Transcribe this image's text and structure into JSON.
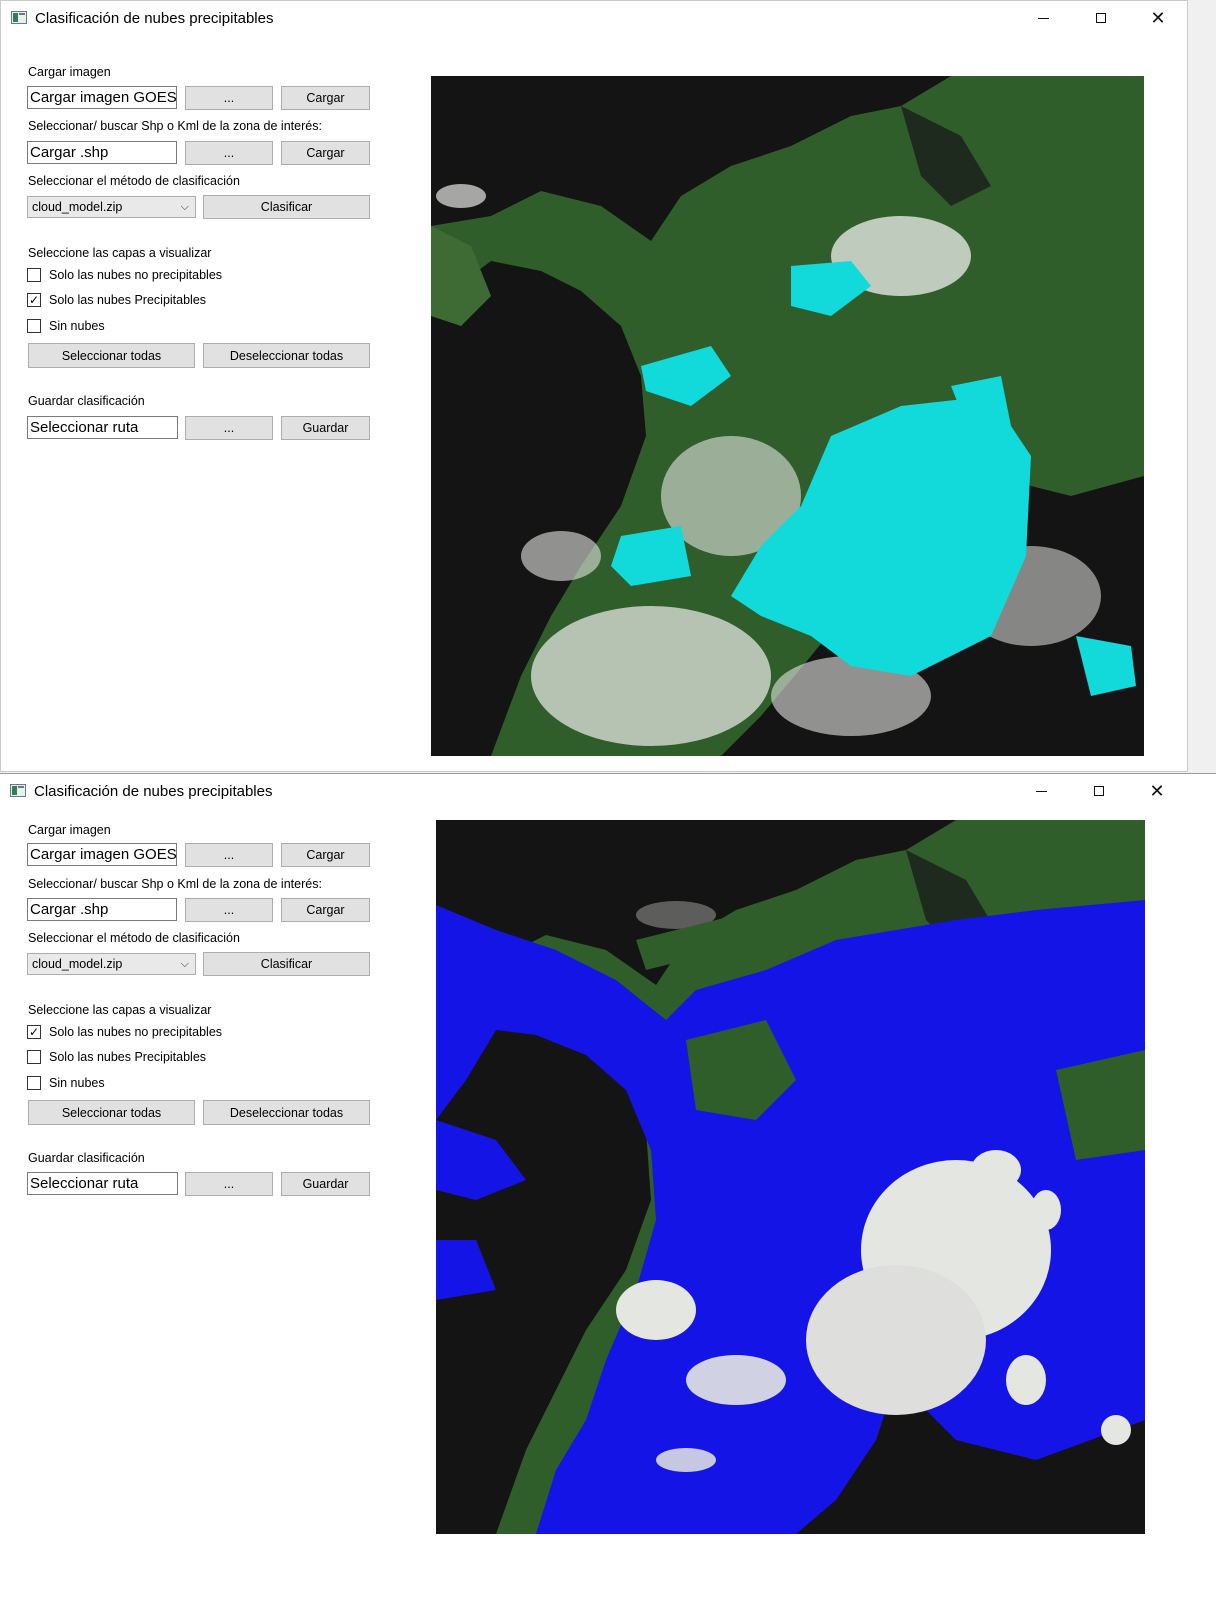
{
  "windows": [
    {
      "id": "window-1",
      "title": "Clasificación de nubes precipitables",
      "load_image": {
        "label": "Cargar imagen",
        "input_value": "Cargar imagen GOES",
        "browse": "...",
        "load": "Cargar"
      },
      "shape_file": {
        "label": "Seleccionar/ buscar Shp o Kml de la zona de interés:",
        "input_value": "Cargar .shp",
        "browse": "...",
        "load": "Cargar"
      },
      "method": {
        "label": "Seleccionar el método de clasificación",
        "selected": "cloud_model.zip",
        "classify": "Clasificar"
      },
      "layers": {
        "label": "Seleccione las capas a visualizar",
        "items": [
          {
            "label": "Solo las nubes no precipitables",
            "checked": false
          },
          {
            "label": "Solo las nubes Precipitables",
            "checked": true
          },
          {
            "label": "Sin nubes",
            "checked": false
          }
        ],
        "select_all": "Seleccionar todas",
        "deselect_all": "Deseleccionar todas"
      },
      "save": {
        "label": "Guardar clasificación",
        "input_value": "Seleccionar ruta",
        "browse": "...",
        "save": "Guardar"
      },
      "map": {
        "overlay_color": "#12d9da",
        "overlay_layer": "precipitable clouds"
      }
    },
    {
      "id": "window-2",
      "title": "Clasificación de nubes precipitables",
      "load_image": {
        "label": "Cargar imagen",
        "input_value": "Cargar imagen GOES",
        "browse": "...",
        "load": "Cargar"
      },
      "shape_file": {
        "label": "Seleccionar/ buscar Shp o Kml de la zona de interés:",
        "input_value": "Cargar .shp",
        "browse": "...",
        "load": "Cargar"
      },
      "method": {
        "label": "Seleccionar el método de clasificación",
        "selected": "cloud_model.zip",
        "classify": "Clasificar"
      },
      "layers": {
        "label": "Seleccione las capas a visualizar",
        "items": [
          {
            "label": "Solo las nubes no precipitables",
            "checked": true
          },
          {
            "label": "Solo las nubes Precipitables",
            "checked": false
          },
          {
            "label": "Sin nubes",
            "checked": false
          }
        ],
        "select_all": "Seleccionar todas",
        "deselect_all": "Deseleccionar todas"
      },
      "save": {
        "label": "Guardar clasificación",
        "input_value": "Seleccionar ruta",
        "browse": "...",
        "save": "Guardar"
      },
      "map": {
        "overlay_color": "#1414e6",
        "overlay_layer": "non-precipitable clouds"
      }
    }
  ],
  "icons": {
    "app": "app-window-icon",
    "minimize": "minimize-icon",
    "maximize": "maximize-icon",
    "close": "close-icon",
    "dropdown": "chevron-down-icon",
    "check": "check-icon"
  },
  "colors": {
    "land": "#2f5e2a",
    "sea": "#141414",
    "cloud": "#e4e6e2"
  }
}
